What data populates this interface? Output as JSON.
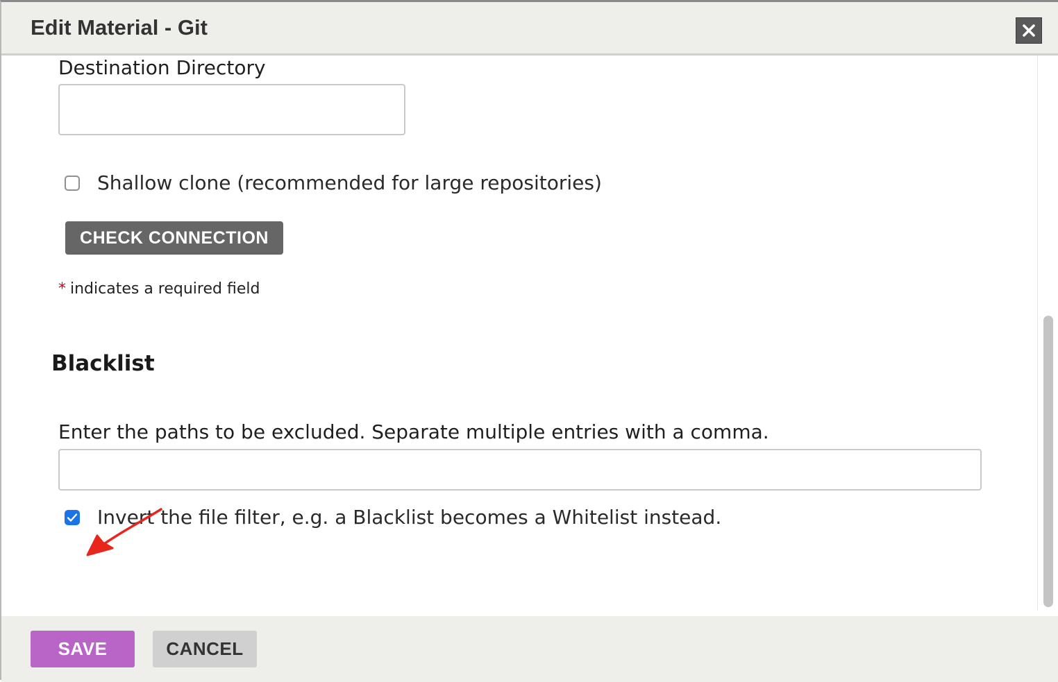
{
  "modal": {
    "title": "Edit Material - Git",
    "close_icon": "close-icon"
  },
  "destination": {
    "label": "Destination Directory",
    "value": ""
  },
  "shallow_clone": {
    "label": "Shallow clone (recommended for large repositories)",
    "checked": false
  },
  "check_connection_label": "CHECK CONNECTION",
  "required_note": {
    "star": "*",
    "text": "indicates a required field"
  },
  "blacklist": {
    "title": "Blacklist",
    "instructions": "Enter the paths to be excluded. Separate multiple entries with a comma.",
    "value": "",
    "invert_label": "Invert the file filter, e.g. a Blacklist becomes a Whitelist instead.",
    "invert_checked": true
  },
  "annotation": {
    "icon": "red-arrow-icon",
    "color": "#e8261c"
  },
  "footer": {
    "save_label": "SAVE",
    "cancel_label": "CANCEL"
  },
  "colors": {
    "save": "#b965c8",
    "cancel": "#d0d0d0",
    "check_connection": "#666666",
    "checkbox_checked": "#1a73e8",
    "required_star": "#d0021b"
  }
}
